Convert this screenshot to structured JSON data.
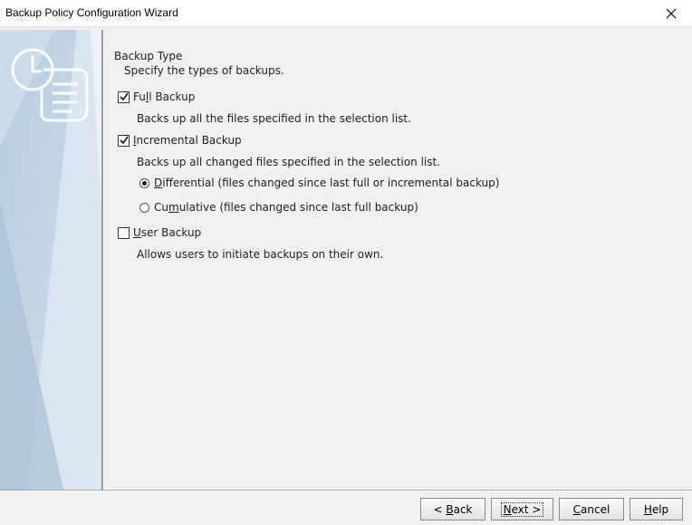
{
  "window": {
    "title": "Backup Policy Configuration Wizard"
  },
  "section": {
    "heading": "Backup Type",
    "subheading": "Specify the types of backups."
  },
  "options": {
    "full": {
      "label_pre": "Fu",
      "label_key": "l",
      "label_post": "l Backup",
      "checked": true,
      "description": "Backs up all the files specified in the selection list."
    },
    "incremental": {
      "label_pre": "",
      "label_key": "I",
      "label_post": "ncremental Backup",
      "checked": true,
      "description": "Backs up all changed files specified in the selection list.",
      "modes": {
        "differential": {
          "label_pre": "",
          "label_key": "D",
          "label_post": "ifferential (files changed since last full or incremental backup)",
          "selected": true
        },
        "cumulative": {
          "label_pre": "Cu",
          "label_key": "m",
          "label_post": "ulative (files changed since last full backup)",
          "selected": false
        }
      }
    },
    "user": {
      "label_pre": "",
      "label_key": "U",
      "label_post": "ser Backup",
      "checked": false,
      "description": "Allows users to initiate backups on their own."
    }
  },
  "buttons": {
    "back": {
      "pre": "< ",
      "key": "B",
      "post": "ack"
    },
    "next": {
      "pre": "",
      "key": "N",
      "post": "ext >"
    },
    "cancel": {
      "pre": "",
      "key": "C",
      "post": "ancel"
    },
    "help": {
      "pre": "",
      "key": "H",
      "post": "elp"
    }
  },
  "icons": {
    "close": "close-icon",
    "wizard": "clock-scroll-icon",
    "check": "check-icon"
  },
  "colors": {
    "panel": "#c6d6e6",
    "background": "#f0f0f0"
  }
}
